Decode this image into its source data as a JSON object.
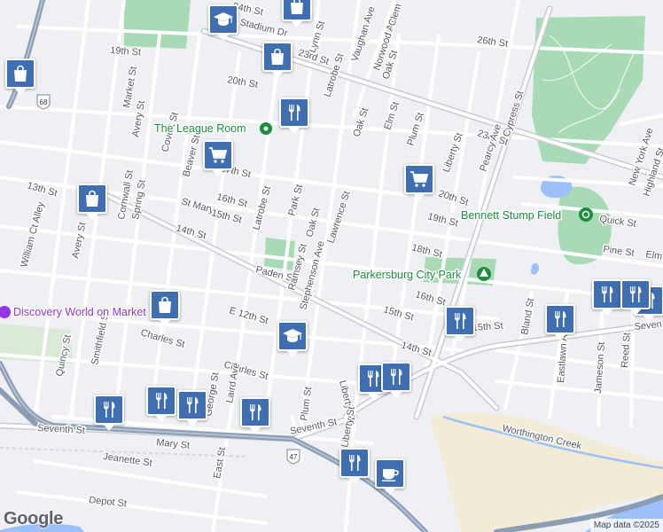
{
  "map": {
    "brand": "Google",
    "attribution": "Map data ©2025",
    "colors": {
      "background": "#eef0f3",
      "road": "#ffffff",
      "major_road": "#c7ccd4",
      "highway": "#8c9db3",
      "park": "#a8dbb5",
      "water": "#9cc0f9",
      "sand": "#f2ecd6",
      "marker": "#3f6fb0",
      "poi_green": "#1e8e3e",
      "poi_purple": "#9334e6"
    },
    "street_labels": [
      "24th St",
      "Stadium Dr",
      "26th St",
      "19th St",
      "Lynn St",
      "Vaughan Ave",
      "Norwood Ave",
      "Clem",
      "Oak St",
      "23rd St",
      "20th St",
      "Market St",
      "Avery St",
      "Latrobe St",
      "Oak St",
      "Elm St",
      "Plum St",
      "Liberty St",
      "23rd St",
      "Cypress St",
      "Pearcy Ave",
      "New York Ave",
      "Highland St",
      "Covert St",
      "Beaver St",
      "17th St",
      "20th St",
      "Quick St",
      "13th St",
      "Cornwall St",
      "Spring St",
      "St Marys",
      "16th St",
      "15th St",
      "Latrobe St",
      "Park St",
      "Lawrence St",
      "19th St",
      "Pine St",
      "Elm",
      "14th St",
      "Oak St",
      "18th St",
      "Avery St",
      "William Ct Alley",
      "Paden St",
      "Ramsey St",
      "Stephenson Ave",
      "16th St",
      "E 12th St",
      "15th St",
      "Charles St",
      "Smithfield St",
      "Quincy St",
      "Bland St",
      "15th St",
      "Eastlawn Ave",
      "Jameson St",
      "Reed St",
      "Seven",
      "14th St",
      "Charles St",
      "Laird Ave",
      "George St",
      "Plum St",
      "Liberty St",
      "Seventh St",
      "Seventh St",
      "Mary St",
      "Jeanette St",
      "East St",
      "Depot St",
      "Worthington Creek",
      "Liberty St",
      "68",
      "47"
    ],
    "places": [
      {
        "name": "The League Room",
        "icon": "pin-icon"
      },
      {
        "name": "Bennett Stump Field",
        "icon": "stadium-icon"
      },
      {
        "name": "Parkersburg City Park",
        "icon": "tree-icon"
      },
      {
        "name": "Discovery World on Market",
        "icon": "museum-icon"
      }
    ],
    "markers": [
      {
        "type": "school",
        "icon": "graduation-cap-icon"
      },
      {
        "type": "shopping",
        "icon": "shopping-bag-icon"
      },
      {
        "type": "shopping",
        "icon": "shopping-bag-icon"
      },
      {
        "type": "shopping",
        "icon": "shopping-bag-icon"
      },
      {
        "type": "restaurant",
        "icon": "fork-knife-icon"
      },
      {
        "type": "grocery",
        "icon": "shopping-cart-icon"
      },
      {
        "type": "grocery",
        "icon": "shopping-cart-icon"
      },
      {
        "type": "shopping",
        "icon": "shopping-bag-icon"
      },
      {
        "type": "shopping",
        "icon": "shopping-bag-icon"
      },
      {
        "type": "school",
        "icon": "graduation-cap-icon"
      },
      {
        "type": "restaurant",
        "icon": "fork-knife-icon"
      },
      {
        "type": "restaurant",
        "icon": "fork-knife-icon"
      },
      {
        "type": "restaurant",
        "icon": "fork-knife-icon"
      },
      {
        "type": "restaurant",
        "icon": "fork-knife-icon"
      },
      {
        "type": "restaurant",
        "icon": "fork-knife-icon"
      },
      {
        "type": "restaurant",
        "icon": "fork-knife-icon"
      },
      {
        "type": "restaurant",
        "icon": "fork-knife-icon"
      },
      {
        "type": "restaurant",
        "icon": "fork-knife-icon"
      },
      {
        "type": "restaurant",
        "icon": "fork-knife-icon"
      },
      {
        "type": "restaurant",
        "icon": "fork-knife-icon"
      },
      {
        "type": "restaurant",
        "icon": "fork-knife-icon"
      },
      {
        "type": "restaurant",
        "icon": "fork-knife-icon"
      },
      {
        "type": "cafe",
        "icon": "coffee-cup-icon"
      }
    ]
  }
}
